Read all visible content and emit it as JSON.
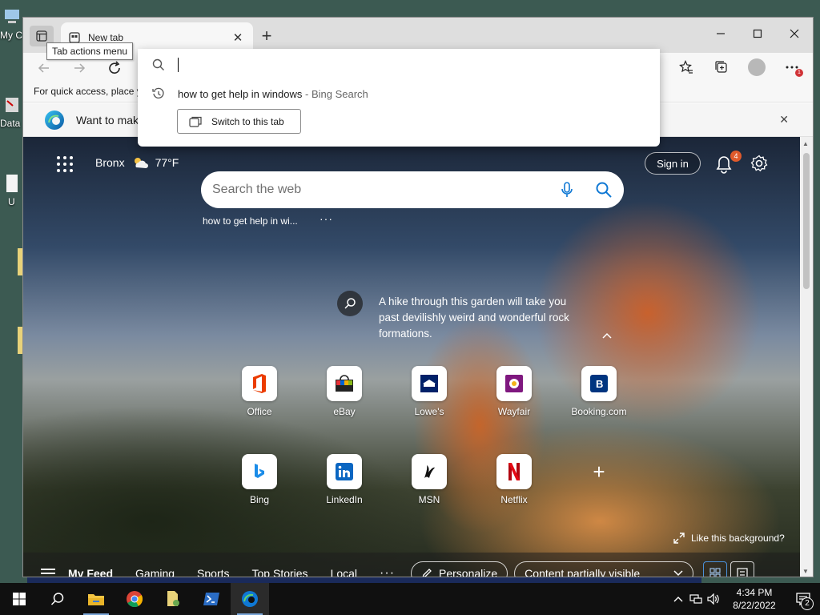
{
  "desktop": {
    "icons": [
      {
        "label": "My C"
      },
      {
        "label": "Data"
      },
      {
        "label": "U"
      }
    ]
  },
  "browser": {
    "tab": {
      "title": "New tab",
      "close_glyph": "✕"
    },
    "tab_actions_tooltip": "Tab actions menu",
    "new_tab_glyph": "+",
    "favorites_bar_text": "For quick access, place y",
    "info_bar_text": "Want to mak",
    "info_bar_close": "✕",
    "toolbar_badge": "1",
    "omnibox": {
      "input_value": "",
      "suggestion": {
        "text": "how to get help in windows",
        "source": "- Bing Search"
      },
      "switch_button": "Switch to this tab"
    }
  },
  "newtab": {
    "weather": {
      "location": "Bronx",
      "temperature": "77°F"
    },
    "sign_in": "Sign in",
    "notification_count": "4",
    "search_placeholder": "Search the web",
    "recent_search": "how to get help in wi...",
    "recent_more": "···",
    "caption": "A hike through this garden will take you past devilishly weird and wonderful rock formations.",
    "caret": "^",
    "tiles": [
      {
        "label": "Office",
        "icon": "office-icon"
      },
      {
        "label": "eBay",
        "icon": "ebay-icon"
      },
      {
        "label": "Lowe's",
        "icon": "lowes-icon"
      },
      {
        "label": "Wayfair",
        "icon": "wayfair-icon"
      },
      {
        "label": "Booking.com",
        "icon": "booking-icon"
      },
      {
        "label": "Bing",
        "icon": "bing-icon"
      },
      {
        "label": "LinkedIn",
        "icon": "linkedin-icon"
      },
      {
        "label": "MSN",
        "icon": "msn-icon"
      },
      {
        "label": "Netflix",
        "icon": "netflix-icon"
      }
    ],
    "add_tile": "+",
    "like_background": "Like this background?",
    "feed_tabs": [
      "My Feed",
      "Gaming",
      "Sports",
      "Top Stories",
      "Local"
    ],
    "feed_more": "···",
    "personalize": "Personalize",
    "content_select": "Content partially visible"
  },
  "taskbar": {
    "time": "4:34 PM",
    "date": "8/22/2022",
    "notification_count": "2"
  },
  "colors": {
    "edge_blue": "#0f78d4",
    "notif_orange": "#e05a2b",
    "netflix_red": "#e50914",
    "booking_navy": "#003580",
    "linkedin_blue": "#0a66c2"
  }
}
